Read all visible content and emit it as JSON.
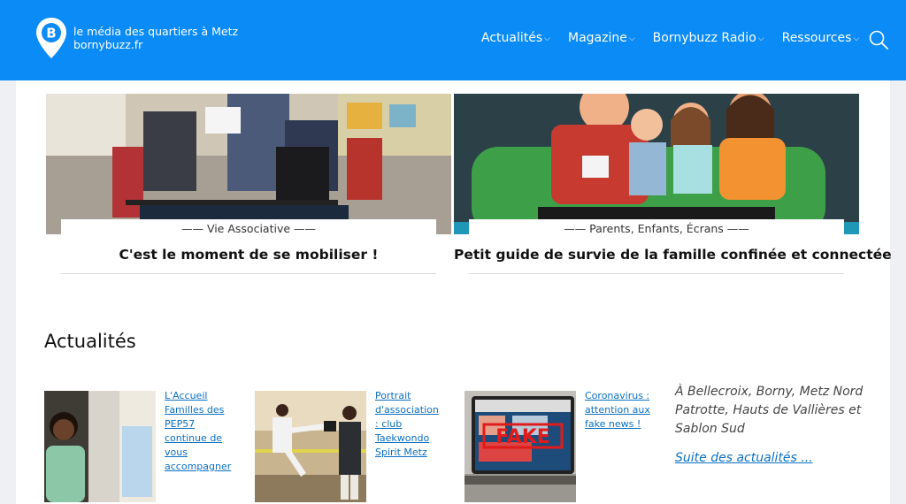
{
  "header": {
    "tagline": "le média des quartiers à Metz",
    "site": "bornybuzz.fr",
    "logo_letter": "B",
    "nav": [
      {
        "label": "Actualités"
      },
      {
        "label": "Magazine"
      },
      {
        "label": "Bornybuzz Radio"
      },
      {
        "label": "Ressources"
      }
    ],
    "brand_color": "#0a8bf5"
  },
  "features": [
    {
      "tag": "Vie Associative",
      "title": "C'est le moment de se mobiliser !"
    },
    {
      "tag": "Parents, Enfants, Écrans",
      "title": "Petit guide de survie de la famille confinée et connectée"
    }
  ],
  "news": {
    "heading": "Actualités",
    "items": [
      {
        "title": "L'Accueil Familles des PEP57 continue de vous accompagner"
      },
      {
        "title": "Portrait d'association : club Taekwondo Spirit Metz"
      },
      {
        "title": "Coronavirus : attention aux fake news !"
      }
    ],
    "side_text": "À Bellecroix, Borny, Metz Nord Patrotte, Hauts de Vallières et Sablon Sud",
    "more_link": "Suite des actualités ...",
    "thumb_overlay": "FAKE"
  }
}
